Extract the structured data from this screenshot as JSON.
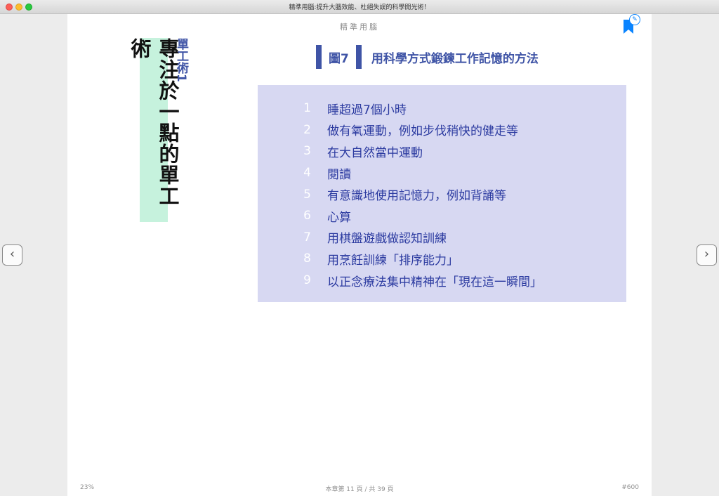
{
  "window": {
    "title": "精準用腦:提升大腦效能、杜絕失誤的科學開光術！"
  },
  "nav": {
    "prev_icon": "chevron-left-icon",
    "next_icon": "chevron-right-icon",
    "prev_glyph": "‹",
    "next_glyph": "›"
  },
  "page": {
    "running_head": "精準用腦",
    "chapter_title": "專注於一點的單工術",
    "chapter_sub": "單工術1",
    "figure": {
      "label": "圖7",
      "title": "用科學方式鍛鍊工作記憶的方法"
    },
    "items": [
      {
        "num": "1",
        "text": "睡超過7個小時"
      },
      {
        "num": "2",
        "text": "做有氧運動，例如步伐稍快的健走等"
      },
      {
        "num": "3",
        "text": "在大自然當中運動"
      },
      {
        "num": "4",
        "text": "閱讀"
      },
      {
        "num": "5",
        "text": "有意識地使用記憶力，例如背誦等"
      },
      {
        "num": "6",
        "text": "心算"
      },
      {
        "num": "7",
        "text": "用棋盤遊戲做認知訓練"
      },
      {
        "num": "8",
        "text": "用烹飪訓練「排序能力」"
      },
      {
        "num": "9",
        "text": "以正念療法集中精神在「現在這一瞬間」"
      }
    ]
  },
  "footer": {
    "progress": "23%",
    "page_info": "本章第 11 頁 / 共 39 頁",
    "location": "#600"
  },
  "colors": {
    "accent": "#3f54a6",
    "box": "#d7d8f2",
    "highlight": "#c6f2dd",
    "bookmark": "#0a84ff"
  }
}
